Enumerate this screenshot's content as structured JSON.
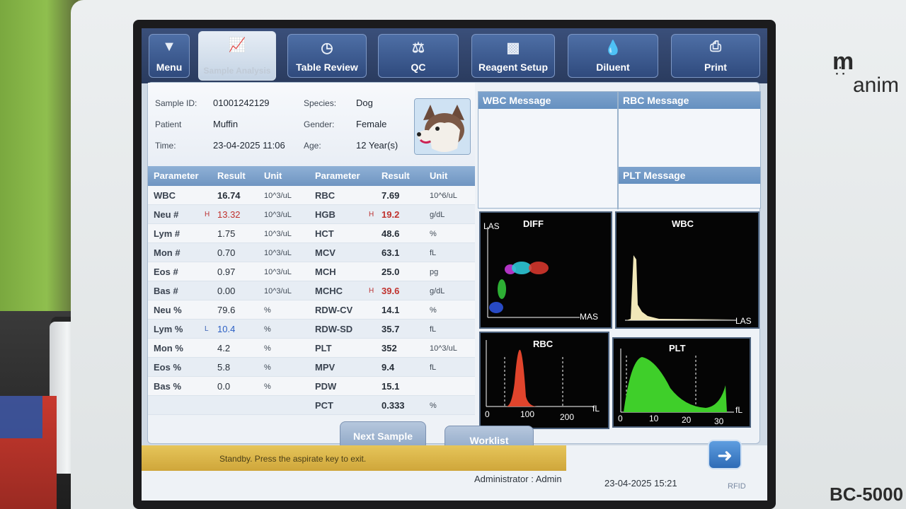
{
  "toolbar": {
    "menu": "Menu",
    "sample_analysis": "Sample Analysis",
    "table_review": "Table Review",
    "qc": "QC",
    "reagent_setup": "Reagent Setup",
    "diluent": "Diluent",
    "print": "Print"
  },
  "sample": {
    "id_label": "Sample ID:",
    "id": "01001242129",
    "patient_label": "Patient",
    "patient": "Muffin",
    "time_label": "Time:",
    "time": "23-04-2025 11:06",
    "species_label": "Species:",
    "species": "Dog",
    "gender_label": "Gender:",
    "gender": "Female",
    "age_label": "Age:",
    "age": "12 Year(s)"
  },
  "table": {
    "headers": [
      "Parameter",
      "Result",
      "Unit",
      "Parameter",
      "Result",
      "Unit"
    ],
    "rows": [
      {
        "p1": "WBC",
        "f1": "",
        "r1": "16.74",
        "u1": "10^3/uL",
        "p2": "RBC",
        "f2": "",
        "r2": "7.69",
        "u2": "10^6/uL"
      },
      {
        "p1": "Neu #",
        "f1": "H",
        "r1": "13.32",
        "u1": "10^3/uL",
        "p2": "HGB",
        "f2": "H",
        "r2": "19.2",
        "u2": "g/dL"
      },
      {
        "p1": "Lym #",
        "f1": "",
        "r1": "1.75",
        "u1": "10^3/uL",
        "p2": "HCT",
        "f2": "",
        "r2": "48.6",
        "u2": "%"
      },
      {
        "p1": "Mon #",
        "f1": "",
        "r1": "0.70",
        "u1": "10^3/uL",
        "p2": "MCV",
        "f2": "",
        "r2": "63.1",
        "u2": "fL"
      },
      {
        "p1": "Eos #",
        "f1": "",
        "r1": "0.97",
        "u1": "10^3/uL",
        "p2": "MCH",
        "f2": "",
        "r2": "25.0",
        "u2": "pg"
      },
      {
        "p1": "Bas #",
        "f1": "",
        "r1": "0.00",
        "u1": "10^3/uL",
        "p2": "MCHC",
        "f2": "H",
        "r2": "39.6",
        "u2": "g/dL"
      },
      {
        "p1": "Neu %",
        "f1": "",
        "r1": "79.6",
        "u1": "%",
        "p2": "RDW-CV",
        "f2": "",
        "r2": "14.1",
        "u2": "%"
      },
      {
        "p1": "Lym %",
        "f1": "L",
        "r1": "10.4",
        "u1": "%",
        "p2": "RDW-SD",
        "f2": "",
        "r2": "35.7",
        "u2": "fL"
      },
      {
        "p1": "Mon %",
        "f1": "",
        "r1": "4.2",
        "u1": "%",
        "p2": "PLT",
        "f2": "",
        "r2": "352",
        "u2": "10^3/uL"
      },
      {
        "p1": "Eos %",
        "f1": "",
        "r1": "5.8",
        "u1": "%",
        "p2": "MPV",
        "f2": "",
        "r2": "9.4",
        "u2": "fL"
      },
      {
        "p1": "Bas %",
        "f1": "",
        "r1": "0.0",
        "u1": "%",
        "p2": "PDW",
        "f2": "",
        "r2": "15.1",
        "u2": ""
      },
      {
        "p1": "",
        "f1": "",
        "r1": "",
        "u1": "",
        "p2": "PCT",
        "f2": "",
        "r2": "0.333",
        "u2": "%"
      }
    ]
  },
  "messages": {
    "wbc": "WBC Message",
    "rbc": "RBC Message",
    "plt": "PLT Message"
  },
  "graphs": {
    "diff": {
      "title": "DIFF",
      "y": "LAS",
      "x": "MAS"
    },
    "wbc": {
      "title": "WBC",
      "x": "LAS"
    },
    "rbc": {
      "title": "RBC",
      "ticks": [
        "0",
        "100",
        "200"
      ],
      "unit": "fL"
    },
    "plt": {
      "title": "PLT",
      "ticks": [
        "0",
        "10",
        "20",
        "30"
      ],
      "unit": "fL"
    }
  },
  "buttons": {
    "next_sample": "Next Sample",
    "worklist": "Worklist"
  },
  "status": {
    "text": "Standby. Press the aspirate key to exit.",
    "user": "Administrator : Admin",
    "datetime": "23-04-2025 15:21",
    "rfid": "RFID"
  },
  "device": {
    "brand": "m",
    "brand_sub": "anim",
    "model": "BC-5000"
  },
  "colors": {
    "high_flag": "#c0322e",
    "low_flag": "#2b5fc4",
    "rbc_curve": "#e0442c",
    "plt_curve": "#3fcf2a",
    "wbc_curve": "#f1e7b8"
  },
  "icons": {
    "menu": "triangle-down-icon",
    "sample_analysis": "chart-icon",
    "table_review": "clock-icon",
    "qc": "balance-icon",
    "reagent_setup": "bottles-icon",
    "diluent": "droplet-icon",
    "print": "printer-icon",
    "next_arrow": "arrow-right-icon",
    "patient": "dog-avatar"
  }
}
